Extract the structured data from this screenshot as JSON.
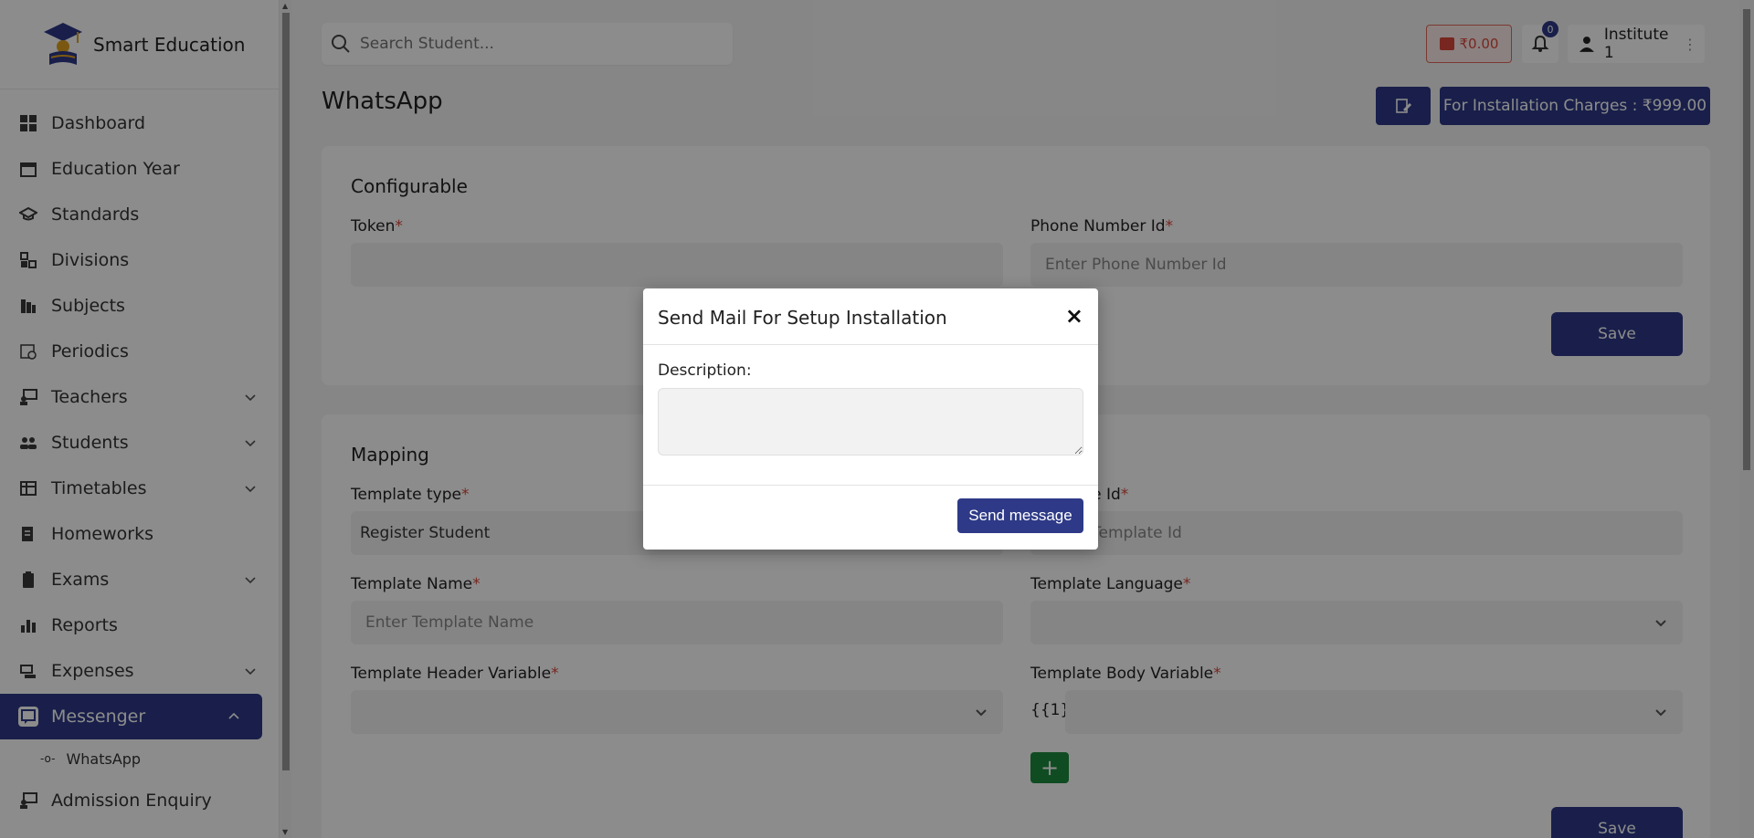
{
  "brand": {
    "title": "Smart Education"
  },
  "sidebar": {
    "items": [
      {
        "label": "Dashboard",
        "icon": "dashboard-icon",
        "chevron": false
      },
      {
        "label": "Education Year",
        "icon": "calendar-icon",
        "chevron": false
      },
      {
        "label": "Standards",
        "icon": "graduation-cap-icon",
        "chevron": false
      },
      {
        "label": "Divisions",
        "icon": "blocks-icon",
        "chevron": false
      },
      {
        "label": "Subjects",
        "icon": "books-icon",
        "chevron": false
      },
      {
        "label": "Periodics",
        "icon": "schedule-icon",
        "chevron": false
      },
      {
        "label": "Teachers",
        "icon": "teacher-icon",
        "chevron": true
      },
      {
        "label": "Students",
        "icon": "students-icon",
        "chevron": true
      },
      {
        "label": "Timetables",
        "icon": "table-icon",
        "chevron": true
      },
      {
        "label": "Homeworks",
        "icon": "homework-icon",
        "chevron": false
      },
      {
        "label": "Exams",
        "icon": "clipboard-icon",
        "chevron": true
      },
      {
        "label": "Reports",
        "icon": "bar-chart-icon",
        "chevron": false
      },
      {
        "label": "Expenses",
        "icon": "expenses-icon",
        "chevron": true
      },
      {
        "label": "Messenger",
        "icon": "message-icon",
        "chevron": true,
        "active": true
      },
      {
        "label": "Admission Enquiry",
        "icon": "enquiry-icon",
        "chevron": false
      }
    ],
    "sub_items": [
      {
        "label": "WhatsApp"
      }
    ]
  },
  "topbar": {
    "search_placeholder": "Search Student...",
    "wallet_amount": "₹0.00",
    "notification_count": "0",
    "user_name": "Institute 1"
  },
  "page": {
    "title": "WhatsApp",
    "install_button": "For Installation Charges : ₹999.00"
  },
  "configurable": {
    "title": "Configurable",
    "token_label": "Token",
    "phone_label": "Phone Number Id",
    "phone_placeholder": "Enter Phone Number Id",
    "save_label": "Save"
  },
  "mapping": {
    "title": "Mapping",
    "template_type_label": "Template type",
    "template_type_value": "Register Student",
    "template_id_label": "Template Id",
    "template_id_placeholder": "Enter Template Id",
    "template_name_label": "Template Name",
    "template_name_placeholder": "Enter Template Name",
    "template_language_label": "Template Language",
    "header_variable_label": "Template Header Variable",
    "body_variable_label": "Template Body Variable",
    "body_variable_prefix": "{{1}}",
    "add_label": "+",
    "save_label": "Save"
  },
  "modal": {
    "title": "Send Mail For Setup Installation",
    "close": "×",
    "description_label": "Description:",
    "send_label": "Send message"
  },
  "colors": {
    "primary": "#2e3a87",
    "danger": "#d9483b",
    "success": "#1e8a3e"
  }
}
